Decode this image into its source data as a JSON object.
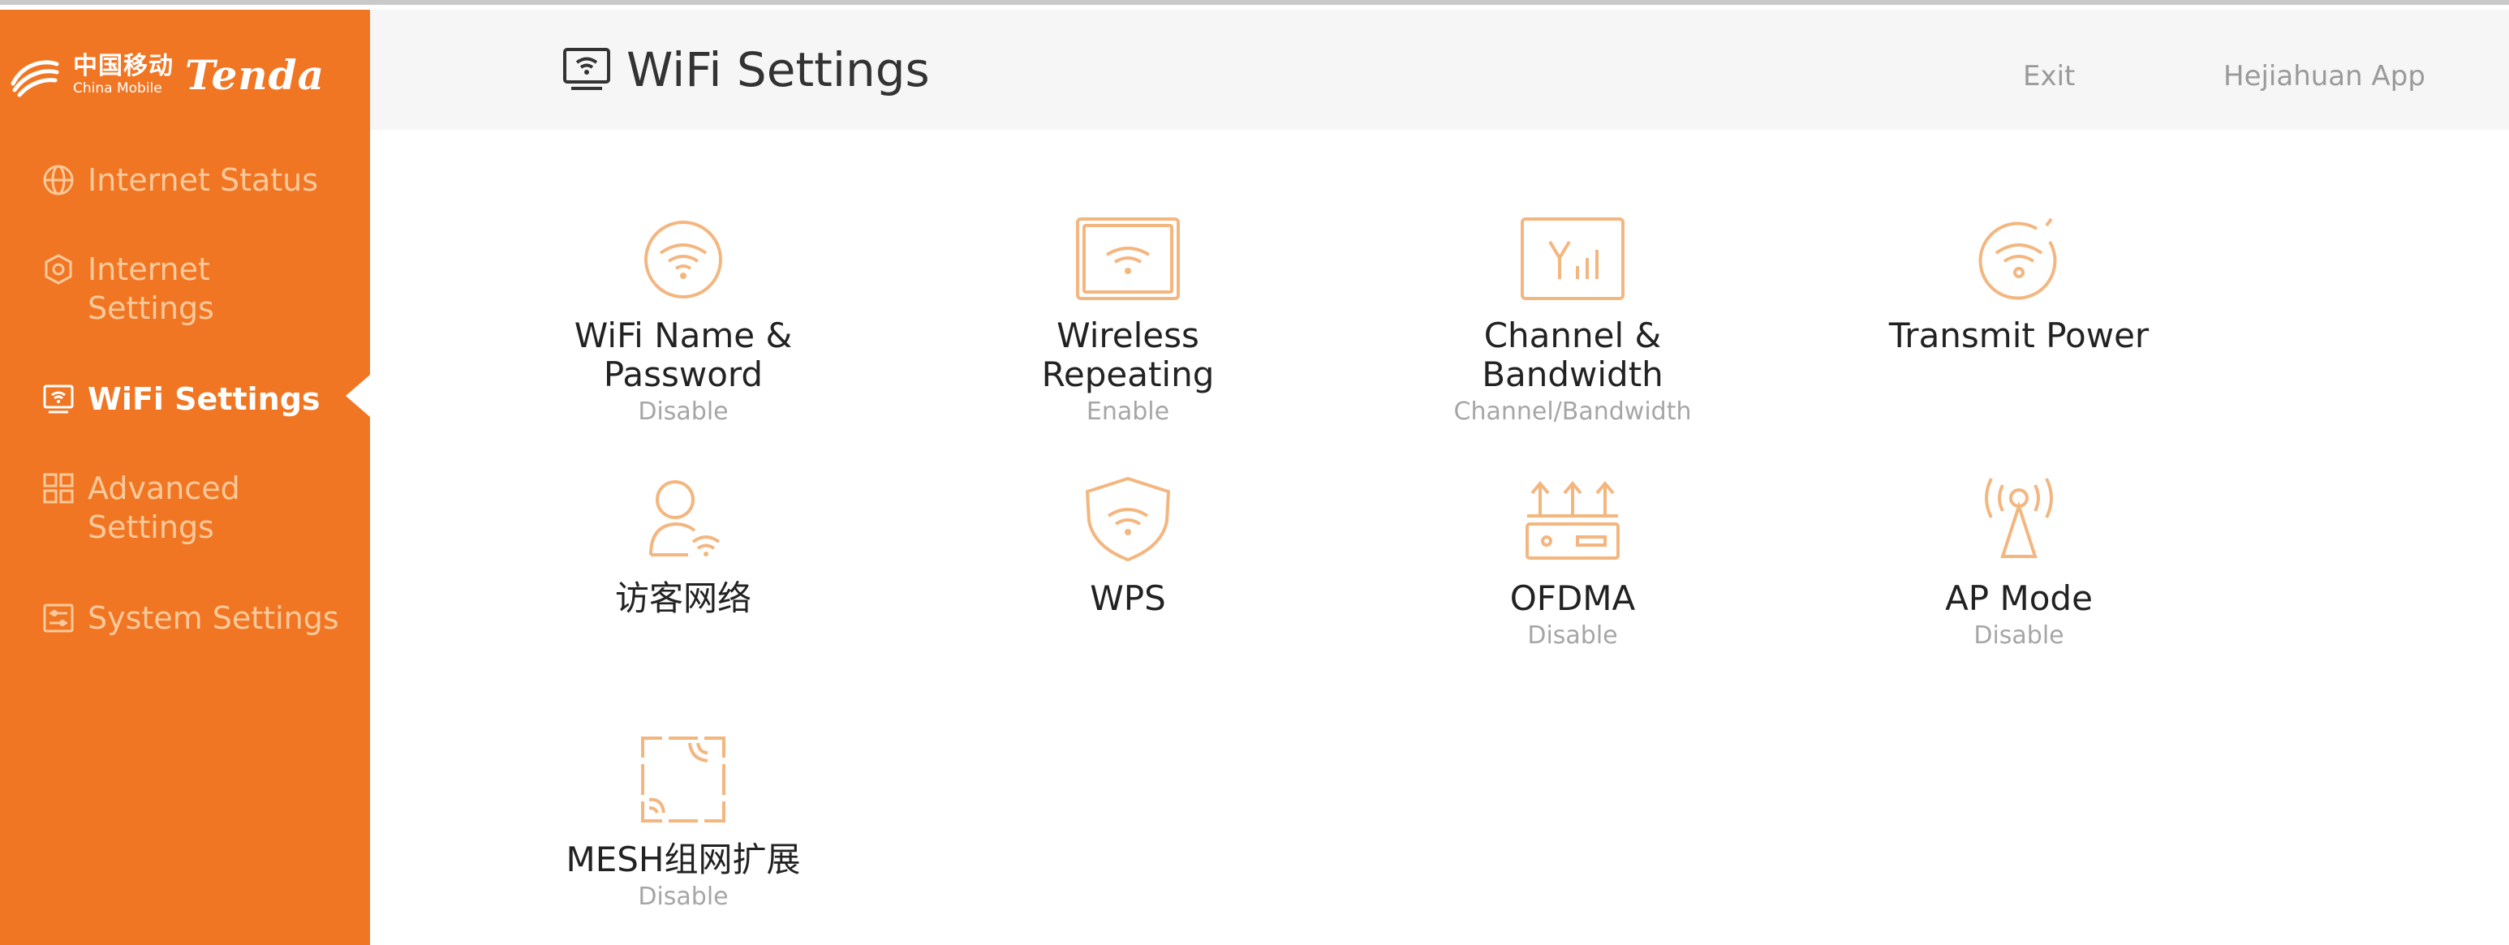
{
  "brand": {
    "carrier_cn": "中国移动",
    "carrier_en": "China Mobile",
    "vendor": "Tenda"
  },
  "colors": {
    "sidebar": "#f07624",
    "accent_icon": "#f4b67f",
    "nav_inactive_text": "#fbc99a",
    "header_bg": "#f6f6f6"
  },
  "sidebar": {
    "items": [
      {
        "label": "Internet Status",
        "icon": "globe-icon"
      },
      {
        "label": "Internet Settings",
        "icon": "settings-cube-icon"
      },
      {
        "label": "WiFi Settings",
        "icon": "wifi-monitor-icon",
        "active": true
      },
      {
        "label": "Advanced Settings",
        "icon": "grid-apps-icon"
      },
      {
        "label": "System Settings",
        "icon": "system-panel-icon"
      }
    ]
  },
  "header": {
    "title": "WiFi Settings",
    "exit_label": "Exit",
    "app_label": "Hejiahuan App"
  },
  "tiles": [
    {
      "label": "WiFi Name & Password",
      "status": "Disable",
      "icon": "wifi-circle-icon"
    },
    {
      "label": "Wireless Repeating",
      "status": "Enable",
      "icon": "wifi-box-icon"
    },
    {
      "label": "Channel & Bandwidth",
      "status": "Channel/Bandwidth",
      "icon": "antenna-signal-icon"
    },
    {
      "label": "Transmit Power",
      "status": "",
      "icon": "wifi-power-icon"
    },
    {
      "label": "访客网络",
      "status": "",
      "icon": "guest-user-icon"
    },
    {
      "label": "WPS",
      "status": "",
      "icon": "wps-shield-icon"
    },
    {
      "label": "OFDMA",
      "status": "Disable",
      "icon": "router-arrows-icon"
    },
    {
      "label": "AP Mode",
      "status": "Disable",
      "icon": "ap-antenna-icon"
    },
    {
      "label": "MESH组网扩展",
      "status": "Disable",
      "icon": "mesh-icon"
    }
  ]
}
